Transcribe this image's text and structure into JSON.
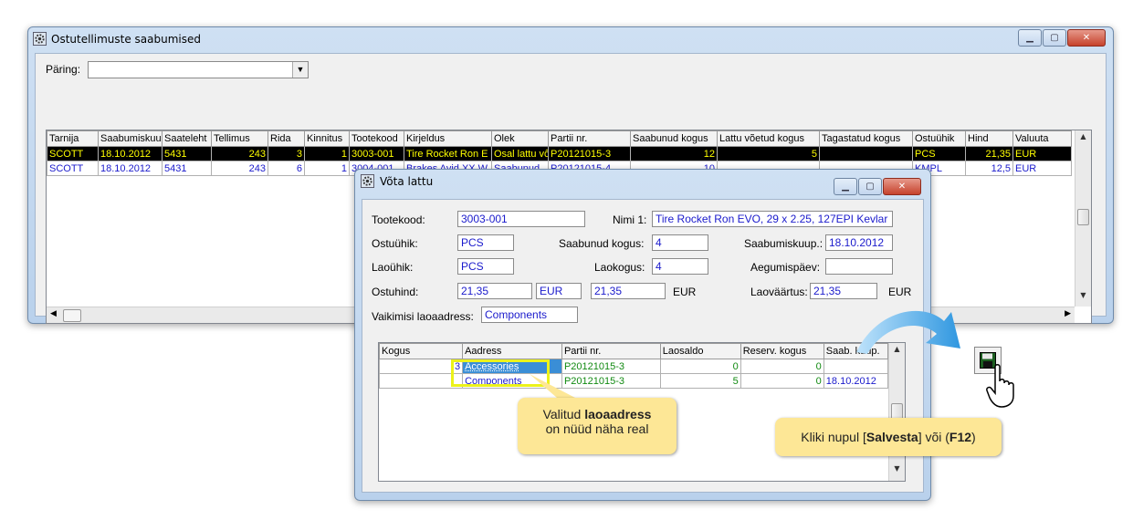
{
  "main_window": {
    "title": "Ostutellimuste saabumised",
    "query_label": "Päring:",
    "query_value": "",
    "columns": [
      "Tarnija",
      "Saabumiskuu",
      "Saateleht",
      "Tellimus",
      "Rida",
      "Kinnitus",
      "Tootekood",
      "Kirjeldus",
      "Olek",
      "Partii nr.",
      "Saabunud kogus",
      "Lattu võetud kogus",
      "Tagastatud kogus",
      "Ostuühik",
      "Hind",
      "Valuuta"
    ],
    "rows": [
      [
        "SCOTT",
        "18.10.2012",
        "5431",
        "243",
        "3",
        "1",
        "3003-001",
        "Tire Rocket Ron E",
        "Osal lattu vô",
        "P20121015-3",
        "12",
        "5",
        "",
        "PCS",
        "21,35",
        "EUR"
      ],
      [
        "SCOTT",
        "18.10.2012",
        "5431",
        "243",
        "6",
        "1",
        "3004-001",
        "Brakes Avid XX W",
        "Saabunud",
        "P20121015-4",
        "10",
        "",
        "",
        "KMPL",
        "12,5",
        "EUR"
      ]
    ]
  },
  "dialog": {
    "title": "Võta lattu",
    "tootekood_label": "Tootekood:",
    "tootekood": "3003-001",
    "nimi_label": "Nimi 1:",
    "nimi": "Tire Rocket Ron EVO, 29 x 2.25, 127EPI Kevlar",
    "ostuuhik_label": "Ostuühik:",
    "ostuuhik": "PCS",
    "saabunud_label": "Saabunud kogus:",
    "saabunud": "4",
    "saabumiskuup_label": "Saabumiskuup.:",
    "saabumiskuup": "18.10.2012",
    "laouhik_label": "Laoühik:",
    "laouhik": "PCS",
    "laokogus_label": "Laokogus:",
    "laokogus": "4",
    "aegumis_label": "Aegumispäev:",
    "aegumis": "",
    "ostuhind_label": "Ostuhind:",
    "ostuhind": "21,35",
    "currency1": "EUR",
    "ostuhind2": "21,35",
    "currency2": "EUR",
    "laovaartus_label": "Laoväärtus:",
    "laovaartus": "21,35",
    "currency3": "EUR",
    "vaikimisi_label": "Vaikimisi laoaadress:",
    "vaikimisi": "Components",
    "columns": [
      "Kogus",
      "Aadress",
      "Partii nr.",
      "Laosaldo",
      "Reserv. kogus",
      "Saab. kuup."
    ],
    "rows": [
      [
        "3",
        "Accessories",
        "P20121015-3",
        "0",
        "0",
        ""
      ],
      [
        "",
        "Components",
        "P20121015-3",
        "5",
        "0",
        "18.10.2012"
      ]
    ]
  },
  "callout_left": {
    "line1_pre": "Valitud ",
    "line1_bold": "laoaadress",
    "line2": "on nüüd näha real"
  },
  "callout_right": {
    "pre": "Kliki nupul [",
    "bold1": "Salvesta",
    "mid": "] või (",
    "bold2": "F12",
    "post": ")"
  },
  "icons": {
    "save": "floppy-disk-icon",
    "cursor": "hand-pointer-icon"
  },
  "colors": {
    "selected_row_bg": "#000000",
    "selected_row_fg": "#ffff00",
    "field_text": "#1a1acc",
    "callout_bg": "#fde796",
    "arrow": "#3aa3e8"
  }
}
